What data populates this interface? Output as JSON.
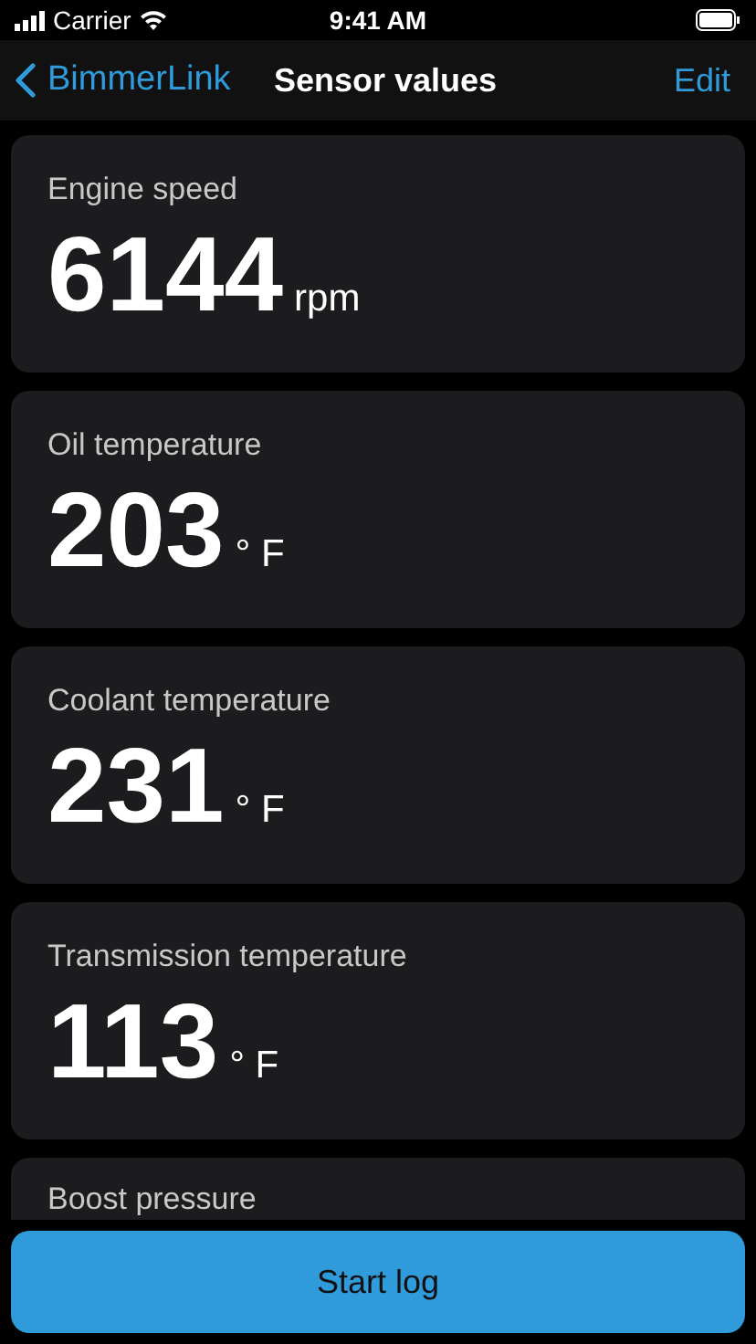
{
  "status_bar": {
    "carrier": "Carrier",
    "time": "9:41 AM"
  },
  "nav": {
    "back": "BimmerLink",
    "title": "Sensor values",
    "action": "Edit"
  },
  "sensors": [
    {
      "label": "Engine speed",
      "value": "6144",
      "unit": "rpm"
    },
    {
      "label": "Oil temperature",
      "value": "203",
      "unit": "° F"
    },
    {
      "label": "Coolant temperature",
      "value": "231",
      "unit": "° F"
    },
    {
      "label": "Transmission temperature",
      "value": "113",
      "unit": "° F"
    },
    {
      "label": "Boost pressure"
    }
  ],
  "button": "Start log"
}
